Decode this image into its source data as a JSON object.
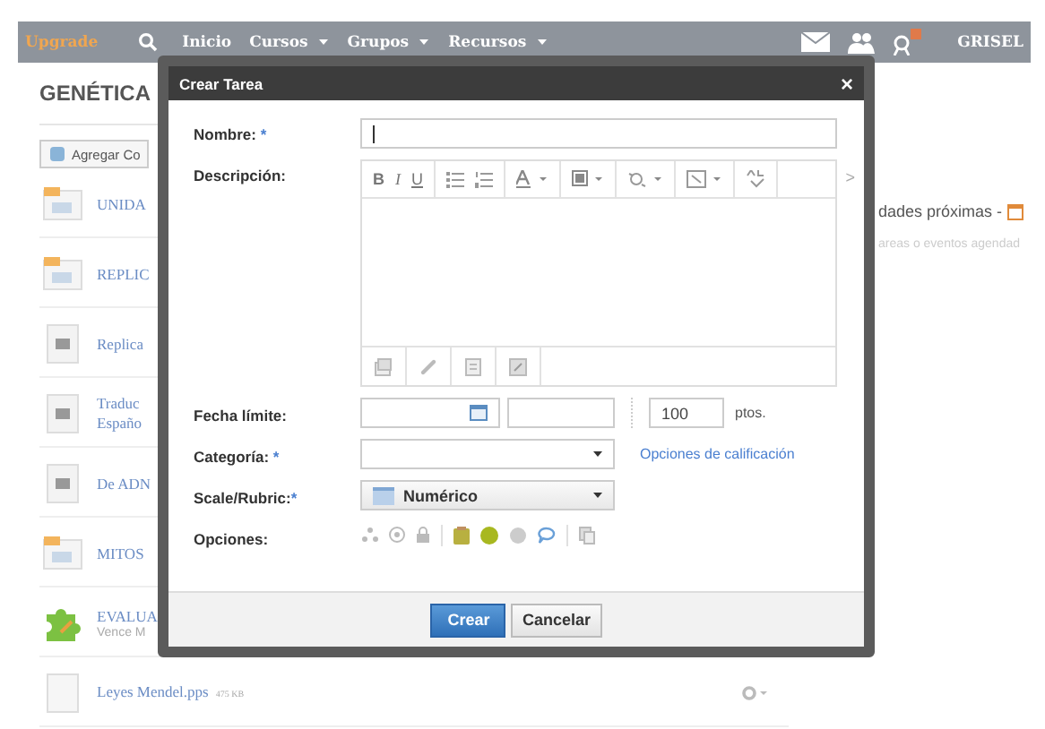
{
  "nav": {
    "brand": "Upgrade",
    "items": [
      {
        "label": "Inicio",
        "dropdown": false
      },
      {
        "label": "Cursos",
        "dropdown": true
      },
      {
        "label": "Grupos",
        "dropdown": true
      },
      {
        "label": "Recursos",
        "dropdown": true
      }
    ],
    "user": "GRISEL"
  },
  "page": {
    "title": "GENÉTICA",
    "add_button": "Agregar Co",
    "items": [
      {
        "kind": "presentation",
        "title": "UNIDA"
      },
      {
        "kind": "presentation",
        "title": "REPLIC"
      },
      {
        "kind": "document",
        "title": "Replica"
      },
      {
        "kind": "document",
        "title": "Traduc",
        "title_2": "Españo"
      },
      {
        "kind": "document",
        "title": "De ADN"
      },
      {
        "kind": "presentation",
        "title": "MITOS"
      },
      {
        "kind": "puzzle",
        "title": "EVALUA",
        "subtitle": "Vence M"
      },
      {
        "kind": "file",
        "title": "Leyes Mendel.pps",
        "size": "475 KB"
      }
    ],
    "upcoming": {
      "title": "dades próximas -",
      "empty_text": "areas o eventos agendad"
    }
  },
  "dialog": {
    "title": "Crear Tarea",
    "close": "×",
    "name": {
      "label": "Nombre:",
      "marker": "*"
    },
    "description": {
      "label": "Descripción:",
      "format_buttons": [
        "B",
        "I",
        "U"
      ],
      "more": ">"
    },
    "due": {
      "label": "Fecha límite:",
      "points": "100",
      "points_unit": "ptos."
    },
    "category": {
      "label": "Categoría:",
      "marker": "*",
      "link": "Opciones de calificación"
    },
    "scale": {
      "label": "Scale/Rubric:",
      "marker": "*",
      "value": "Numérico"
    },
    "options": {
      "label": "Opciones:"
    },
    "buttons": [
      {
        "label": "Crear",
        "primary": true
      },
      {
        "label": "Cancelar",
        "primary": false
      }
    ]
  }
}
